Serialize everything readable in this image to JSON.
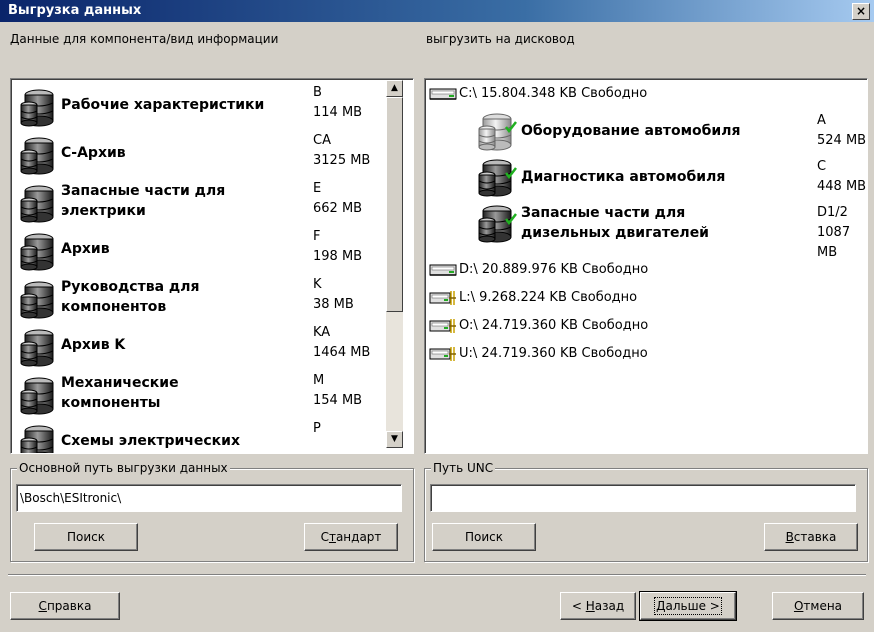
{
  "window": {
    "title": "Выгрузка данных",
    "close": "×"
  },
  "left_label": "Данные для компонента/вид информации",
  "right_label": "выгрузить на дисковод",
  "components": [
    {
      "name": [
        "Рабочие характеристики"
      ],
      "code": "B",
      "size": "114 MB"
    },
    {
      "name": [
        "С-Архив"
      ],
      "code": "CA",
      "size": "3125 MB"
    },
    {
      "name": [
        "Запасные части для",
        "электрики"
      ],
      "code": "E",
      "size": "662 MB"
    },
    {
      "name": [
        "Архив"
      ],
      "code": "F",
      "size": "198 MB"
    },
    {
      "name": [
        "Руководства для",
        "компонентов"
      ],
      "code": "K",
      "size": "38 MB"
    },
    {
      "name": [
        "Архив K"
      ],
      "code": "KA",
      "size": "1464 MB"
    },
    {
      "name": [
        "Механические",
        "компоненты"
      ],
      "code": "M",
      "size": "154 MB"
    },
    {
      "name": [
        "Схемы электрических"
      ],
      "code": "P",
      "size": ""
    }
  ],
  "drives": [
    {
      "label": "C:\\ 15.804.348 KB Свободно"
    },
    {
      "label": "D:\\ 20.889.976 KB Свободно"
    },
    {
      "label": "L:\\ 9.268.224 KB Свободно"
    },
    {
      "label": "O:\\ 24.719.360 KB Свободно"
    },
    {
      "label": "U:\\ 24.719.360 KB Свободно"
    }
  ],
  "drive_items": [
    {
      "name": [
        "Оборудование автомобиля"
      ],
      "code": "A",
      "size": "524 MB"
    },
    {
      "name": [
        "Диагностика автомобиля"
      ],
      "code": "C",
      "size": "448 MB"
    },
    {
      "name": [
        "Запасные части для",
        "дизельных двигателей"
      ],
      "code": "D1/2",
      "size": "1087 MB"
    }
  ],
  "main_path": {
    "title": "Основной путь выгрузки данных",
    "value": "\\Bosch\\ESItronic\\",
    "search": "Поиск",
    "standard_pre": "С",
    "standard_u": "т",
    "standard_post": "андарт"
  },
  "unc": {
    "title": "Путь UNC",
    "value": "",
    "search": "Поиск",
    "insert_u": "В",
    "insert_post": "ставка"
  },
  "footer": {
    "help_u": "С",
    "help_post": "правка",
    "back_pre": "< ",
    "back_u": "Н",
    "back_post": "азад",
    "next_u": "Д",
    "next_post": "альше >",
    "cancel_u": "О",
    "cancel_post": "тмена"
  },
  "colors": {
    "title_bg": "#0a246a",
    "face": "#d4d0c8",
    "check": "#20b020"
  }
}
